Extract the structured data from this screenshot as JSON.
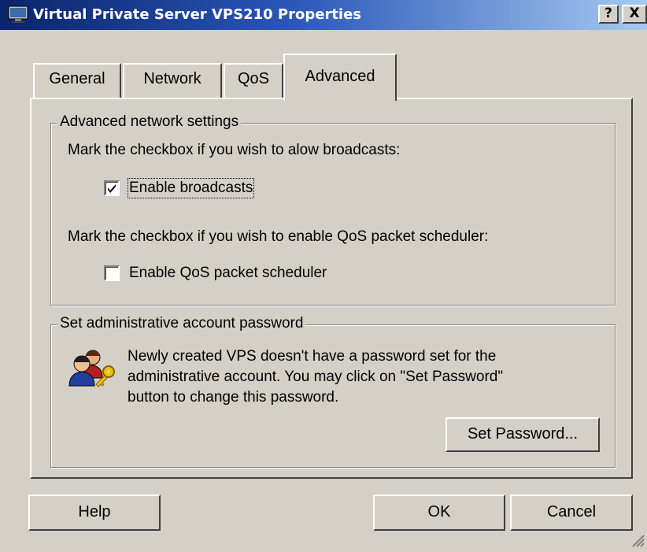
{
  "window": {
    "title": "Virtual Private Server VPS210 Properties",
    "help_glyph": "?",
    "close_glyph": "X",
    "title_gradient_start": "#0a246a",
    "title_gradient_end": "#a6caf0"
  },
  "tabs": [
    {
      "label": "General",
      "selected": false
    },
    {
      "label": "Network",
      "selected": false
    },
    {
      "label": "QoS",
      "selected": false
    },
    {
      "label": "Advanced",
      "selected": true
    }
  ],
  "advanced_network": {
    "legend": "Advanced network settings",
    "broadcast_prompt": "Mark the checkbox if you wish to alow broadcasts:",
    "broadcast_label": "Enable broadcasts",
    "broadcast_checked": true,
    "qos_prompt": "Mark the checkbox if you wish to enable QoS packet scheduler:",
    "qos_label": "Enable QoS packet scheduler",
    "qos_checked": false
  },
  "password_section": {
    "legend": "Set administrative account password",
    "line1": "Newly created VPS doesn't have a password set for the",
    "line2": "administrative account. You may click on \"Set Password\"",
    "line3": "button to change this password.",
    "icon": "users-key-icon",
    "set_password_label": "Set Password..."
  },
  "buttons": {
    "help": "Help",
    "ok": "OK",
    "cancel": "Cancel"
  }
}
